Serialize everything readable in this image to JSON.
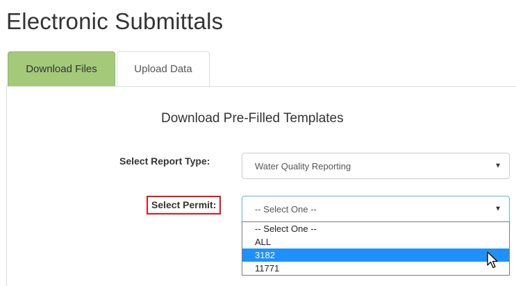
{
  "page": {
    "title": "Electronic Submittals"
  },
  "tabs": [
    {
      "label": "Download Files",
      "active": true
    },
    {
      "label": "Upload Data",
      "active": false
    }
  ],
  "panel": {
    "heading": "Download Pre-Filled Templates",
    "report_type": {
      "label": "Select Report Type:",
      "value": "Water Quality Reporting"
    },
    "permit": {
      "label": "Select Permit:",
      "value": "-- Select One --",
      "options": [
        "-- Select One --",
        "ALL",
        "3182",
        "11771"
      ],
      "highlighted_option": "3182"
    }
  },
  "colors": {
    "active_tab": "#a3c979",
    "highlight_box": "#e0141a",
    "option_highlight": "#1e90ff"
  },
  "icons": {
    "caret": "caret-down-icon",
    "cursor": "mouse-pointer-icon"
  }
}
